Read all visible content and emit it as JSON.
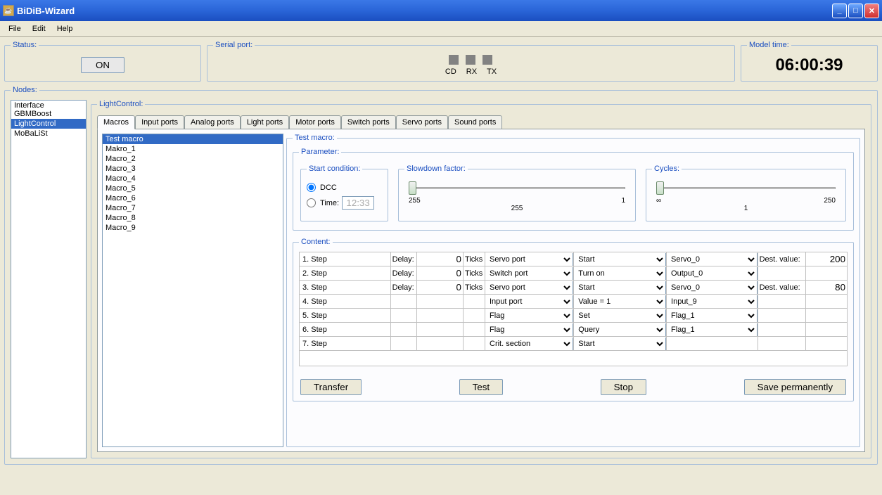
{
  "window": {
    "title": "BiDiB-Wizard"
  },
  "menu": {
    "file": "File",
    "edit": "Edit",
    "help": "Help"
  },
  "status": {
    "legend": "Status:",
    "on": "ON"
  },
  "serial": {
    "legend": "Serial port:",
    "cd": "CD",
    "rx": "RX",
    "tx": "TX"
  },
  "clock": {
    "legend": "Model time:",
    "value": "06:00:39"
  },
  "nodes": {
    "legend": "Nodes:",
    "items": [
      "Interface GBMBoost",
      "LightControl",
      "MoBaLiSt"
    ],
    "selected": 1
  },
  "lc": {
    "legend": "LightControl:"
  },
  "tabs": {
    "items": [
      "Macros",
      "Input ports",
      "Analog ports",
      "Light ports",
      "Motor ports",
      "Switch ports",
      "Servo ports",
      "Sound ports"
    ],
    "active": 0
  },
  "macros": {
    "items": [
      "Test macro",
      "Makro_1",
      "Macro_2",
      "Macro_3",
      "Macro_4",
      "Macro_5",
      "Macro_6",
      "Macro_7",
      "Macro_8",
      "Macro_9"
    ],
    "selected": 0
  },
  "detail": {
    "legend": "Test macro:",
    "parameter": "Parameter:",
    "start": {
      "legend": "Start condition:",
      "dcc": "DCC",
      "time": "Time:",
      "time_value": "12:33"
    },
    "slowdown": {
      "legend": "Slowdown factor:",
      "min": "255",
      "max": "1",
      "mid": "255"
    },
    "cycles": {
      "legend": "Cycles:",
      "min": "∞",
      "max": "250",
      "mid": "1"
    },
    "content": "Content:",
    "steps": [
      {
        "label": "1. Step",
        "delay_lbl": "Delay:",
        "delay": "0",
        "ticks": "Ticks",
        "c1": "Servo port",
        "c2": "Start",
        "c3": "Servo_0",
        "dest_lbl": "Dest. value:",
        "dest": "200"
      },
      {
        "label": "2. Step",
        "delay_lbl": "Delay:",
        "delay": "0",
        "ticks": "Ticks",
        "c1": "Switch port",
        "c2": "Turn on",
        "c3": "Output_0",
        "dest_lbl": "",
        "dest": ""
      },
      {
        "label": "3. Step",
        "delay_lbl": "Delay:",
        "delay": "0",
        "ticks": "Ticks",
        "c1": "Servo port",
        "c2": "Start",
        "c3": "Servo_0",
        "dest_lbl": "Dest. value:",
        "dest": "80"
      },
      {
        "label": "4. Step",
        "delay_lbl": "",
        "delay": "",
        "ticks": "",
        "c1": "Input port",
        "c2": "Value = 1",
        "c3": "Input_9",
        "dest_lbl": "",
        "dest": ""
      },
      {
        "label": "5. Step",
        "delay_lbl": "",
        "delay": "",
        "ticks": "",
        "c1": "Flag",
        "c2": "Set",
        "c3": "Flag_1",
        "dest_lbl": "",
        "dest": ""
      },
      {
        "label": "6. Step",
        "delay_lbl": "",
        "delay": "",
        "ticks": "",
        "c1": "Flag",
        "c2": "Query",
        "c3": "Flag_1",
        "dest_lbl": "",
        "dest": ""
      },
      {
        "label": "7. Step",
        "delay_lbl": "",
        "delay": "",
        "ticks": "",
        "c1": "Crit. section",
        "c2": "Start",
        "c3": "",
        "dest_lbl": "",
        "dest": ""
      }
    ],
    "buttons": {
      "transfer": "Transfer",
      "test": "Test",
      "stop": "Stop",
      "save": "Save permanently"
    }
  }
}
